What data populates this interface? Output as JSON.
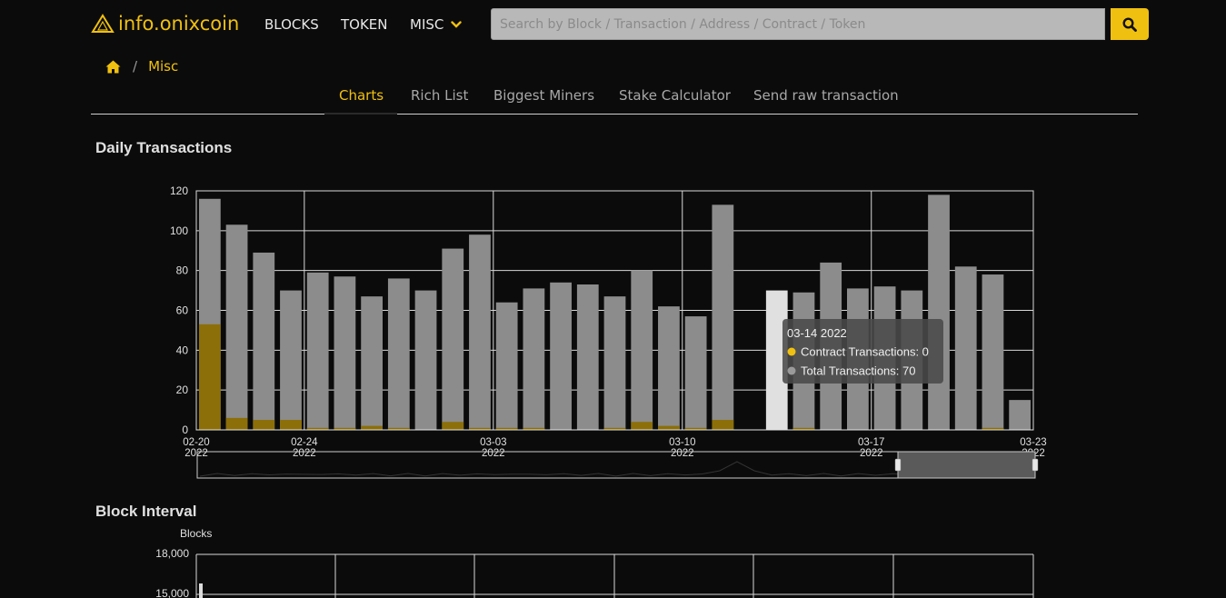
{
  "nav": {
    "brand": "info.onixcoin",
    "items": [
      "BLOCKS",
      "TOKEN",
      "MISC"
    ]
  },
  "search": {
    "placeholder": "Search by Block / Transaction / Address / Contract / Token"
  },
  "icons": {
    "logo": "triangle-logo-icon",
    "misc_dropdown": "chevron-down-icon",
    "search": "search-icon",
    "home": "home-icon"
  },
  "colors": {
    "accent": "#f0c010",
    "background": "#0b0b0b",
    "total_bar": "#8c8c8c",
    "contract_bar": "#8c6f08",
    "highlight_bar": "#e0e0e0"
  },
  "breadcrumb": {
    "separator": "/",
    "current": "Misc"
  },
  "tabs": [
    {
      "label": "Charts",
      "active": true
    },
    {
      "label": "Rich List",
      "active": false
    },
    {
      "label": "Biggest Miners",
      "active": false
    },
    {
      "label": "Stake Calculator",
      "active": false
    },
    {
      "label": "Send raw transaction",
      "active": false
    }
  ],
  "sections": {
    "daily_title": "Daily Transactions",
    "interval_title": "Block Interval"
  },
  "chart_data": [
    {
      "type": "bar",
      "title": "Daily Transactions",
      "stacked": false,
      "ylim": [
        0,
        120
      ],
      "yticks": [
        0,
        20,
        40,
        60,
        80,
        100,
        120
      ],
      "x_date_range": [
        "2022-02-20",
        "2022-03-23"
      ],
      "xtick_labels": [
        {
          "date": "2022-02-20",
          "label": "02-20",
          "year": "2022"
        },
        {
          "date": "2022-02-24",
          "label": "02-24",
          "year": "2022"
        },
        {
          "date": "2022-03-03",
          "label": "03-03",
          "year": "2022"
        },
        {
          "date": "2022-03-10",
          "label": "03-10",
          "year": "2022"
        },
        {
          "date": "2022-03-17",
          "label": "03-17",
          "year": "2022"
        },
        {
          "date": "2022-03-23",
          "label": "03-23",
          "year": "2022"
        }
      ],
      "dates": [
        "2022-02-21",
        "2022-02-22",
        "2022-02-23",
        "2022-02-24",
        "2022-02-25",
        "2022-02-26",
        "2022-02-27",
        "2022-02-28",
        "2022-03-01",
        "2022-03-02",
        "2022-03-03",
        "2022-03-04",
        "2022-03-05",
        "2022-03-06",
        "2022-03-07",
        "2022-03-08",
        "2022-03-09",
        "2022-03-10",
        "2022-03-11",
        "2022-03-12",
        "2022-03-13",
        "2022-03-14",
        "2022-03-15",
        "2022-03-16",
        "2022-03-17",
        "2022-03-18",
        "2022-03-19",
        "2022-03-20",
        "2022-03-21",
        "2022-03-22",
        "2022-03-23"
      ],
      "series": [
        {
          "name": "Total Transactions",
          "values": [
            116,
            103,
            89,
            70,
            79,
            77,
            67,
            76,
            70,
            91,
            98,
            64,
            71,
            74,
            73,
            67,
            80,
            62,
            57,
            113,
            0,
            70,
            69,
            84,
            71,
            72,
            70,
            118,
            82,
            78,
            15
          ]
        },
        {
          "name": "Contract Transactions",
          "values": [
            53,
            6,
            5,
            5,
            1,
            1,
            2,
            1,
            0,
            4,
            1,
            1,
            1,
            0,
            0,
            1,
            4,
            2,
            1,
            5,
            0,
            0,
            1,
            0,
            0,
            0,
            0,
            0,
            0,
            1,
            0
          ]
        }
      ],
      "highlight_index": 21,
      "tooltip": {
        "title": "03-14 2022",
        "rows": [
          {
            "label": "Contract Transactions: 0",
            "color": "#f0c010"
          },
          {
            "label": "Total Transactions: 70",
            "color": "#9a9a9a"
          }
        ]
      },
      "legend": "none",
      "grid": true
    },
    {
      "type": "bar",
      "title": "Block Interval",
      "ylabel": "Blocks",
      "ylim_visible_ticks": [
        "18,000",
        "15,000"
      ],
      "grid": true
    }
  ]
}
